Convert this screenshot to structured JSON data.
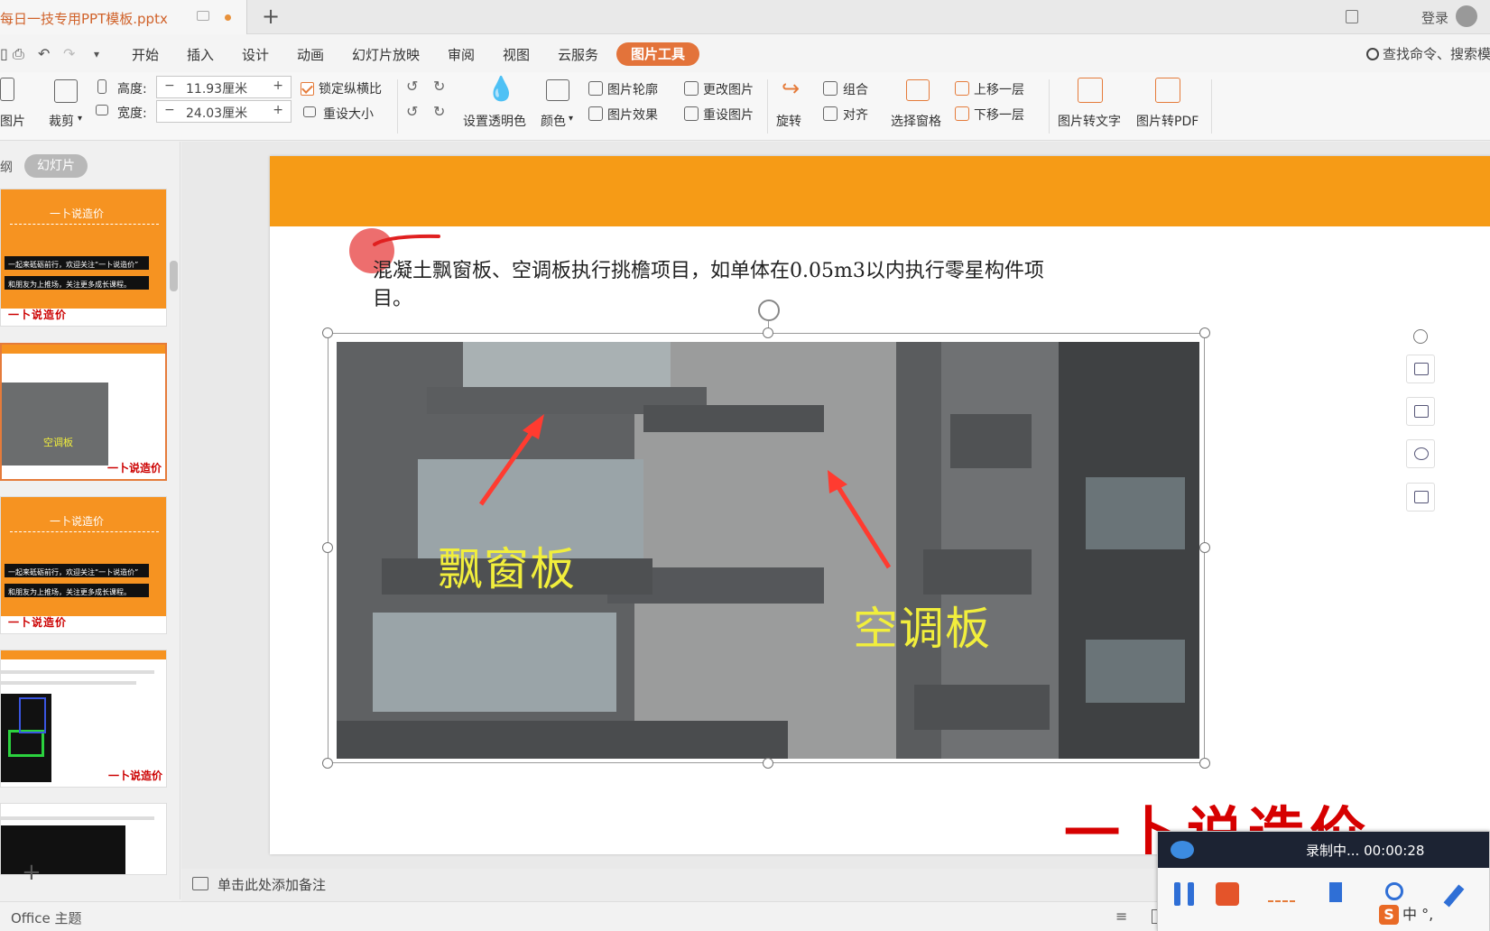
{
  "titlebar": {
    "doc_title": "每日一技专用PPT模板.pptx",
    "new_tab": "+",
    "login": "登录"
  },
  "menubar": {
    "items": [
      "开始",
      "插入",
      "设计",
      "动画",
      "幻灯片放映",
      "审阅",
      "视图",
      "云服务"
    ],
    "active": "图片工具",
    "search": "查找命令、搜索模"
  },
  "ribbon": {
    "insert_image": "图片",
    "crop": "裁剪",
    "height_label": "高度:",
    "height_value": "11.93厘米",
    "width_label": "宽度:",
    "width_value": "24.03厘米",
    "minus": "−",
    "plus": "+",
    "lock_ratio": "锁定纵横比",
    "reset_size": "重设大小",
    "set_transparent": "设置透明色",
    "color": "颜色",
    "outline": "图片轮廓",
    "effect": "图片效果",
    "change_image": "更改图片",
    "reset_image": "重设图片",
    "rotate": "旋转",
    "group": "组合",
    "align": "对齐",
    "selection_pane": "选择窗格",
    "bring_forward": "上移一层",
    "send_backward": "下移一层",
    "to_text": "图片转文字",
    "to_pdf": "图片转PDF"
  },
  "leftpane": {
    "outline_tab": "纲",
    "slides_tab": "幻灯片",
    "thumb_title": "一卜说造价",
    "thumb_line1": "一起来砥砺前行，欢迎关注“一卜说造价”",
    "thumb_line2": "和朋友为上推场，关注更多成长课程。",
    "thumb_sig": "一卜说造价",
    "thumb2_label": "空调板",
    "add": "+"
  },
  "slide": {
    "body_text": "混凝土飘窗板、空调板执行挑檐项目，如单体在0.05m3以内执行零星构件项目。",
    "label_bay": "飘窗板",
    "label_ac": "空调板",
    "signature": "一卜说造价"
  },
  "notes": {
    "placeholder": "单击此处添加备注"
  },
  "statusbar": {
    "theme": "Office 主题"
  },
  "recorder": {
    "status": "录制中... 00:00:28"
  },
  "ime": {
    "logo": "S",
    "text": "中 °,"
  },
  "colors": {
    "accent": "#e3733a",
    "slide_header": "#f69b16",
    "photo_label": "#f1ee3c",
    "signature_red": "#d60000"
  }
}
